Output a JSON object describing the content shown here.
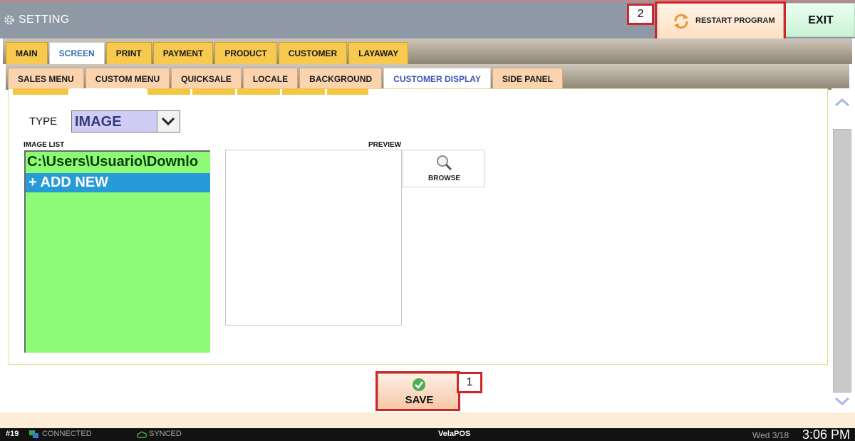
{
  "window": {
    "title": "SETTING",
    "gear_icon": "gear-icon"
  },
  "header": {
    "restart_label": "RESTART PROGRAM",
    "restart_icon": "refresh-icon",
    "exit_label": "EXIT"
  },
  "annotations": {
    "save_marker": "1",
    "restart_marker": "2",
    "color": "#d0262b"
  },
  "main_tabs": [
    {
      "label": "MAIN"
    },
    {
      "label": "SCREEN"
    },
    {
      "label": "PRINT"
    },
    {
      "label": "PAYMENT"
    },
    {
      "label": "PRODUCT"
    },
    {
      "label": "CUSTOMER"
    },
    {
      "label": "LAYAWAY"
    }
  ],
  "sub_tabs": [
    {
      "label": "SALES MENU"
    },
    {
      "label": "CUSTOM MENU"
    },
    {
      "label": "QUICKSALE"
    },
    {
      "label": "LOCALE"
    },
    {
      "label": "BACKGROUND"
    },
    {
      "label": "CUSTOMER DISPLAY"
    },
    {
      "label": "SIDE PANEL"
    }
  ],
  "active_main_tab": "SCREEN",
  "active_sub_tab": "CUSTOMER DISPLAY",
  "content": {
    "type_label": "TYPE",
    "type_value": "IMAGE",
    "image_list_label": "IMAGE LIST",
    "image_list_items": [
      "C:\\Users\\Usuario\\Downlo"
    ],
    "add_new_label": "+ ADD NEW",
    "preview_label": "PREVIEW",
    "browse_label": "BROWSE"
  },
  "footer": {
    "save_label": "SAVE"
  },
  "statusbar": {
    "station": "#19",
    "connection": "CONNECTED",
    "sync": "SYNCED",
    "brand": "VelaPOS",
    "date": "Wed 3/18",
    "time": "3:06 PM"
  },
  "colors": {
    "titlebar": "#8f98a5",
    "tab_yellow": "#f7c94f",
    "subtab_peach": "#fbd3ae",
    "list_green": "#8dfb75",
    "add_new_blue": "#279bd8",
    "select_lavender": "#cfcdf5"
  }
}
